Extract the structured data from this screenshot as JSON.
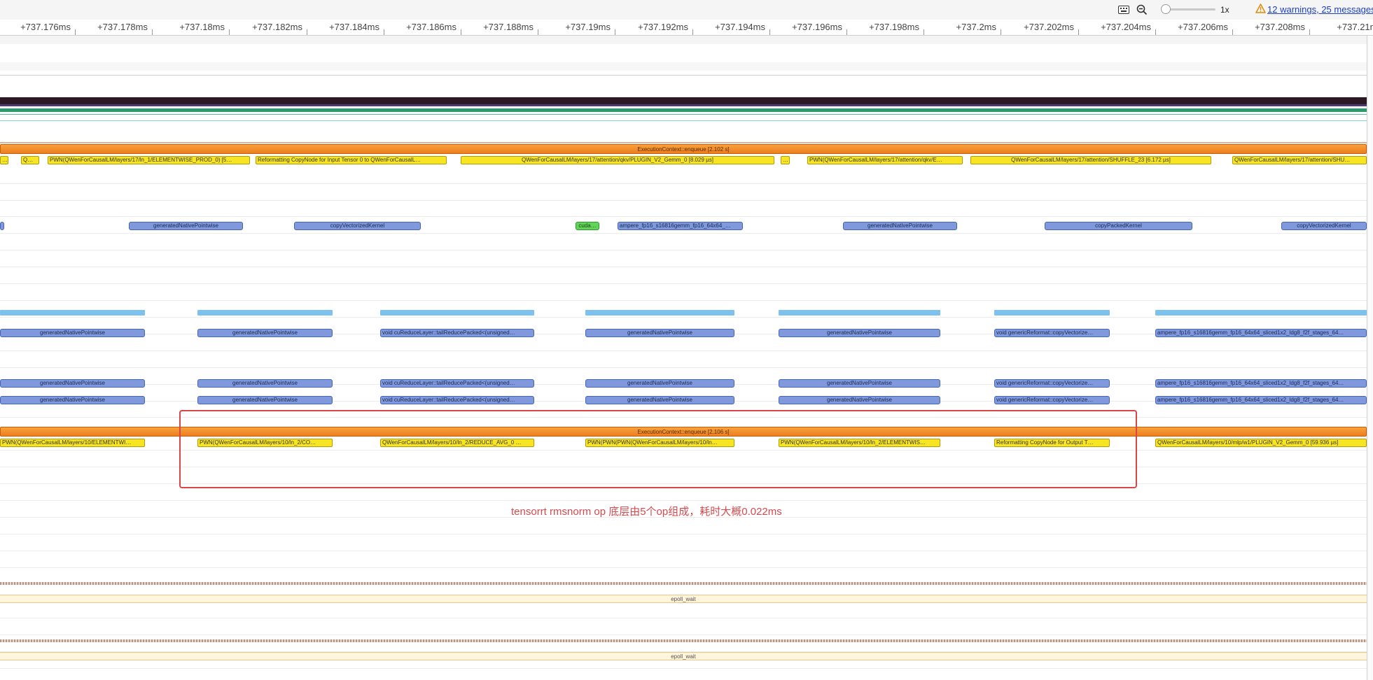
{
  "toolbar": {
    "zoom_level": "1x",
    "warnings_link": "12 warnings, 25 messages",
    "icons": [
      "keyboard-icon",
      "zoom-out-icon",
      "warning-icon"
    ]
  },
  "ruler": {
    "ticks": [
      "+737.176ms",
      "+737.178ms",
      "+737.18ms",
      "+737.182ms",
      "+737.184ms",
      "+737.186ms",
      "+737.188ms",
      "+737.19ms",
      "+737.192ms",
      "+737.194ms",
      "+737.196ms",
      "+737.198ms",
      "+737.2ms",
      "+737.202ms",
      "+737.204ms",
      "+737.206ms",
      "+737.208ms",
      "+737.21ms"
    ]
  },
  "row1": {
    "enqueue": "ExecutionContext::enqueue [2.102 s]",
    "slices": [
      "…",
      "QW…",
      "PWN(QWenForCausalLM/layers/17/ln_1/ELEMENTWISE_PROD_0) [5…",
      "Reformatting CopyNode for Input Tensor 0 to QWenForCausalL…",
      "QWenForCausalLM/layers/17/attention/qkv/PLUGIN_V2_Gemm_0 [8.029 µs]",
      "…",
      "PWN(QWenForCausalLM/layers/17/attention/qkv/E…",
      "QWenForCausalLM/layers/17/attention/SHUFFLE_23 [6.172 µs]",
      "QWenForCausalLM/layers/17/attention/SHU…"
    ]
  },
  "row2": {
    "slices": [
      "generatedNativePointwise",
      "copyVectorizedKernel",
      "cuda…",
      "ampere_fp16_s16816gemm_fp16_64x64_…",
      "generatedNativePointwise",
      "copyPackedKernel",
      "copyVectorizedKernel"
    ]
  },
  "row3": {
    "slices": [
      "generatedNativePointwise",
      "generatedNativePointwise",
      "void cuReduceLayer::tailReducePacked<(unsigned…",
      "generatedNativePointwise",
      "generatedNativePointwise",
      "void genericReformat::copyVectorize…",
      "ampere_fp16_s16816gemm_fp16_64x64_sliced1x2_ldg8_f2f_stages_64…"
    ]
  },
  "row5": {
    "enqueue": "ExecutionContext::enqueue [2.106 s]",
    "slices": [
      "PWN(QWenForCausalLM/layers/10/ELEMENTWI…",
      "PWN(QWenForCausalLM/layers/10/ln_2/CO…",
      "QWenForCausalLM/layers/10/ln_2/REDUCE_AVG_0 …",
      "PWN(PWN(PWN(QWenForCausalLM/layers/10/ln…",
      "PWN(QWenForCausalLM/layers/10/ln_2/ELEMENTWIS…",
      "Reformatting CopyNode for Output T…",
      "QWenForCausalLM/layers/10/mlp/w1/PLUGIN_V2_Gemm_0 [59.936 µs]"
    ]
  },
  "epoll": {
    "label": "epoll_wait"
  },
  "annotation": {
    "text": "tensorrt rmsnorm op 底层由5个op组成，耗时大概0.022ms"
  },
  "colors": {
    "enqueue": "#ee7d1f",
    "cpu_op": "#f7e524",
    "kernel": "#7f99dc",
    "memcpy": "#61d45a",
    "highlight": "#d9464a",
    "dark_track": "#2b1a24",
    "green_track": "#2e9a6c"
  }
}
